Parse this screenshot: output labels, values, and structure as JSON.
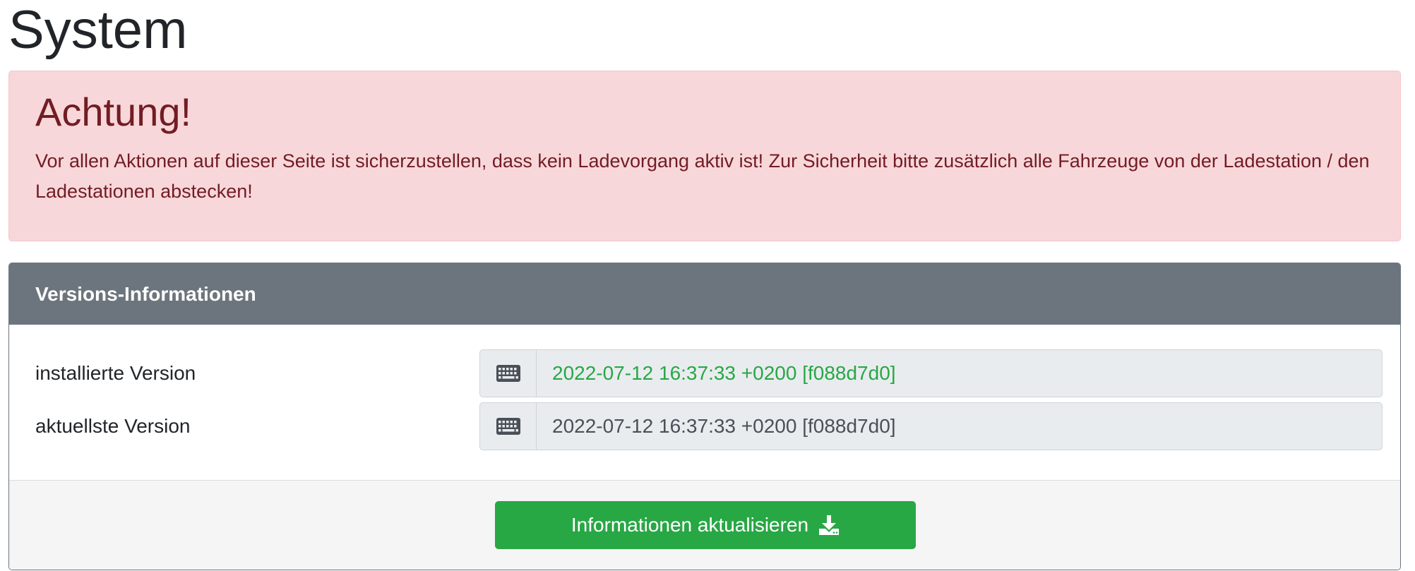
{
  "page": {
    "title": "System"
  },
  "alert": {
    "heading": "Achtung!",
    "text": "Vor allen Aktionen auf dieser Seite ist sicherzustellen, dass kein Ladevorgang aktiv ist! Zur Sicherheit bitte zusätzlich alle Fahrzeuge von der Ladestation / den Ladestationen abstecken!",
    "colors": {
      "background": "#f8d7da",
      "text": "#721c24"
    }
  },
  "versions_card": {
    "header": "Versions-Informationen",
    "rows": [
      {
        "label": "installierte Version",
        "icon": "keyboard-icon",
        "value": "2022-07-12 16:37:33 +0200 [f088d7d0]",
        "value_color": "#28a745"
      },
      {
        "label": "aktuellste Version",
        "icon": "keyboard-icon",
        "value": "2022-07-12 16:37:33 +0200 [f088d7d0]",
        "value_color": "#495057"
      }
    ],
    "footer": {
      "button_label": "Informationen aktualisieren",
      "button_icon": "download-icon",
      "button_color": "#28a745"
    },
    "header_color": "#6c757d"
  }
}
